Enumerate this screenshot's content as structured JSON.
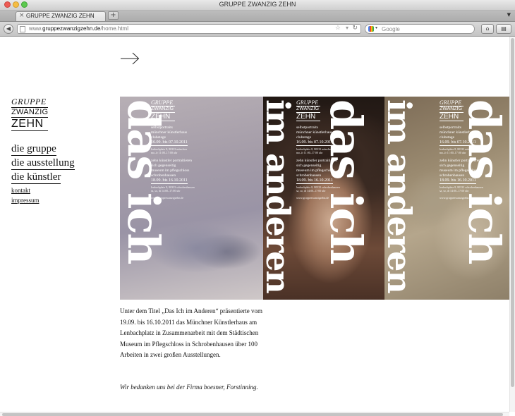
{
  "window": {
    "title": "GRUPPE ZWANZIG ZEHN"
  },
  "tabs": [
    {
      "label": "GRUPPE ZWANZIG ZEHN",
      "close": "×"
    }
  ],
  "new_tab": "+",
  "toolbar": {
    "back": "◀",
    "url_prefix": "www.",
    "url_domain": "gruppezwanzigzehn.de",
    "url_path": "/home.html",
    "bookmark_star": "☆",
    "reload": "↻",
    "search_placeholder": "Google",
    "home": "⌂",
    "bookmarks": "▤"
  },
  "page": {
    "logo": {
      "line1": "GRUPPE",
      "line2": "ZWANZIG",
      "line3": "ZEHN"
    },
    "nav": {
      "main": [
        "die gruppe",
        "die ausstellung",
        "die künstler"
      ],
      "small": [
        "kontakt",
        "impressum"
      ]
    },
    "posters": [
      {
        "vertical_main": "das ich",
        "vertical_sub": "im anderen"
      },
      {
        "vertical_main": "das ich",
        "vertical_sub": "im anderen"
      },
      {
        "vertical_main": "das ich",
        "vertical_sub": "im anderen"
      }
    ],
    "poster_info": {
      "logo1": "GRUPPE",
      "logo2": "ZWANZIG",
      "logo3": "ZEHN",
      "block1": "selbstportraits\nmünchner künstlerhaus\nclubetage",
      "date1": "16.09. bis 07.10.2011",
      "tiny1": "lenbachplatz 8, 80333 münchen\nmo–fr 11:00–17:00 uhr",
      "block2": "zehn künstler portraitieren\nsich gegenseitig\nmuseum im pflegschloss\nschrobenhausen",
      "date2": "18.09. bis 16.10.2011",
      "tiny2": "lenbachplatz 8, 80333 schrobenhausen\nsa, so, di 14:00–17:00 uhr",
      "web": "www.gruppezwanzigzehn.de"
    },
    "description": "Unter dem Titel „Das Ich im Anderen“ präsentierte vom 19.09. bis 16.10.2011 das Münchner Künstlerhaus am Lenbachplatz in Zusammenarbeit mit dem Städtischen Museum im Pflegschloss in Schrobenhausen über 100 Arbeiten in zwei großen Ausstellungen.",
    "thanks": "Wir bedanken uns bei der Firma boesner, Forstinning."
  }
}
